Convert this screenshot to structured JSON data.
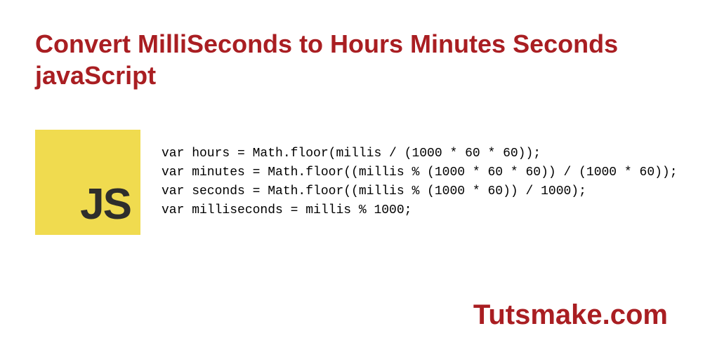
{
  "title": "Convert MilliSeconds to Hours Minutes Seconds javaScript",
  "logo": {
    "text": "JS"
  },
  "code": {
    "lines": [
      "var hours = Math.floor(millis / (1000 * 60 * 60));",
      "var minutes = Math.floor((millis % (1000 * 60 * 60)) / (1000 * 60));",
      "var seconds = Math.floor((millis % (1000 * 60)) / 1000);",
      "var milliseconds = millis % 1000;"
    ]
  },
  "footer": "Tutsmake.com"
}
